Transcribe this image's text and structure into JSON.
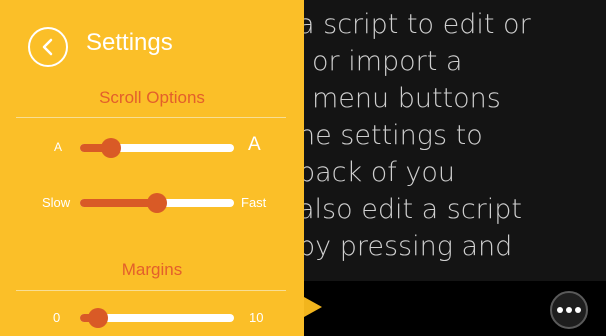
{
  "settings": {
    "title": "Settings",
    "back_icon": "chevron-left-icon",
    "scroll_options": {
      "header": "Scroll Options",
      "text_size": {
        "min_label": "A",
        "max_label": "A",
        "value_fraction": 0.2
      },
      "speed": {
        "min_label": "Slow",
        "max_label": "Fast",
        "value_fraction": 0.5
      }
    },
    "margins": {
      "header": "Margins",
      "slider": {
        "min_label": "0",
        "max_label": "10",
        "value_fraction": 0.12
      }
    }
  },
  "prompter": {
    "lines": [
      "a script to edit or",
      "or import a",
      "menu buttons",
      "he settings to",
      "back of you",
      "also edit a script",
      "by pressing and"
    ]
  },
  "toolbar": {
    "play_icon": "play-marker-icon",
    "more_icon": "more-options-icon"
  },
  "colors": {
    "panel": "#fbbf28",
    "accent": "#d95a26",
    "header": "#e35f2b",
    "background": "#141414"
  }
}
